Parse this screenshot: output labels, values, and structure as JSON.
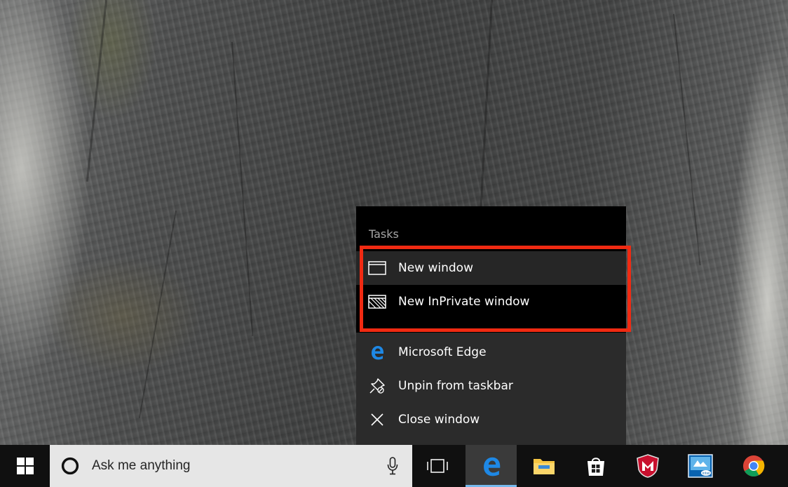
{
  "jumplist": {
    "tasks_heading": "Tasks",
    "tasks": [
      {
        "label": "New window",
        "icon": "window-icon"
      },
      {
        "label": "New InPrivate window",
        "icon": "inprivate-window-icon"
      }
    ],
    "app_items": [
      {
        "label": "Microsoft Edge",
        "icon": "edge-icon"
      },
      {
        "label": "Unpin from taskbar",
        "icon": "unpin-icon"
      },
      {
        "label": "Close window",
        "icon": "close-icon"
      }
    ],
    "highlight_color": "#f02a12"
  },
  "taskbar": {
    "search_placeholder": "Ask me anything",
    "items": [
      {
        "name": "start-button",
        "icon": "windows-logo-icon"
      },
      {
        "name": "task-view-button",
        "icon": "task-view-icon"
      },
      {
        "name": "edge-taskbar-button",
        "icon": "edge-icon",
        "active": true
      },
      {
        "name": "file-explorer-button",
        "icon": "folder-icon"
      },
      {
        "name": "store-button",
        "icon": "store-icon"
      },
      {
        "name": "mcafee-button",
        "icon": "mcafee-icon"
      },
      {
        "name": "intel-button",
        "icon": "intel-graphics-icon"
      },
      {
        "name": "chrome-button",
        "icon": "chrome-icon"
      }
    ],
    "accent_color": "#76b9ed"
  }
}
